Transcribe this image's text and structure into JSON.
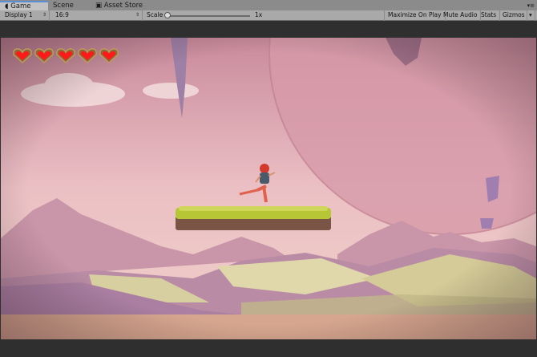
{
  "tabs": [
    {
      "label": "Game",
      "icon": "game-controller-icon",
      "active": true
    },
    {
      "label": "Scene",
      "active": false
    },
    {
      "label": "Asset Store",
      "icon": "store-bag-icon",
      "active": false
    }
  ],
  "toolbar": {
    "display": "Display 1",
    "aspect": "16:9",
    "scale_label": "Scale",
    "scale_value": "1x",
    "scale_fraction": 0,
    "maximize_on_play": "Maximize On Play",
    "mute_audio": "Mute Audio",
    "stats": "Stats",
    "gizmos": "Gizmos"
  },
  "game": {
    "hearts": 5,
    "heart_color": "#ff1a1a",
    "sky_color": "#d9a0ad"
  }
}
